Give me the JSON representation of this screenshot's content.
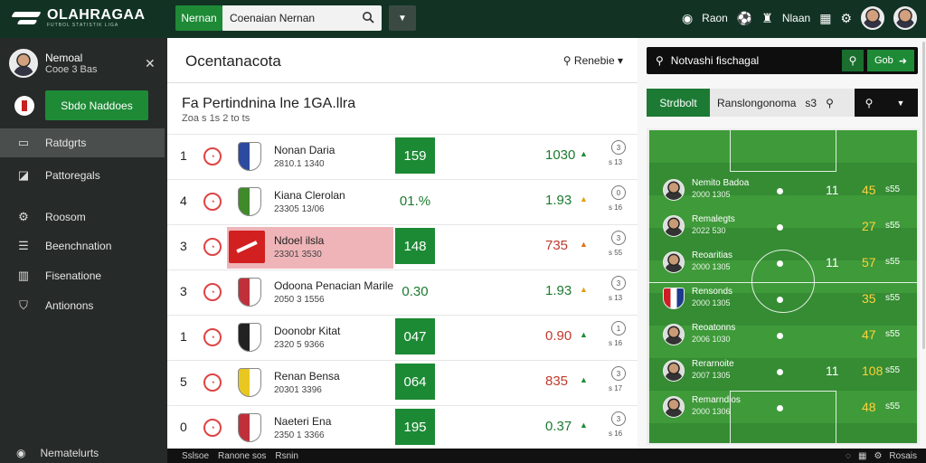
{
  "topbar": {
    "logo": "OLAHRAGAA",
    "logo_tagline": "FUTBOL STATISTIK LIGA",
    "tab": "Nernan",
    "search_value": "Coenaian Nernan",
    "right_items": [
      "Raon",
      "Nlaan"
    ]
  },
  "sidebar": {
    "user_name": "Nemoal",
    "user_sub": "Cooe 3 Bas",
    "cta": "Sbdo Naddoes",
    "items": [
      {
        "label": "Ratdgrts",
        "icon": "list-icon"
      },
      {
        "label": "Pattoregals",
        "icon": "tag-icon"
      },
      {
        "label": "Roosom",
        "icon": "settings-icon"
      },
      {
        "label": "Beenchnation",
        "icon": "table-icon"
      },
      {
        "label": "Fisenatione",
        "icon": "chart-icon"
      },
      {
        "label": "Antionons",
        "icon": "shield-icon"
      }
    ],
    "bottom": "Nematelurts"
  },
  "middle": {
    "title": "Ocentanacota",
    "filter": "Renebie",
    "section_title": "Fa Pertindnina lne 1GA.llra",
    "section_sub": "Zoa s 1s 2 to ts",
    "rows": [
      {
        "rank": "1",
        "name": "Nonan Daria",
        "meta": "2810.1 1340",
        "score": "159",
        "value": "1030",
        "value_color": "#1c7a30",
        "trend": "▲",
        "trend_color": "#1c8a34",
        "highlight": false,
        "crest": "#2c4aa0",
        "act": "3",
        "act_sub": "s 13"
      },
      {
        "rank": "4",
        "name": "Kiana Clerolan",
        "meta": "23305 13/06",
        "score": "01.%",
        "score_plain": true,
        "value": "1.93",
        "value_color": "#1c7a30",
        "trend": "▲",
        "trend_color": "#e0a010",
        "highlight": false,
        "crest": "#3f8a2a",
        "act": "0",
        "act_sub": "s 16"
      },
      {
        "rank": "3",
        "name": "Ndoel ilsla",
        "meta": "23301 3530",
        "score": "148",
        "value": "735",
        "value_color": "#c0392b",
        "trend": "▲",
        "trend_color": "#e07010",
        "highlight": true,
        "crest": "#d21f1f",
        "act": "3",
        "act_sub": "s 55"
      },
      {
        "rank": "3",
        "name": "Odoona Penacian Marile",
        "meta": "2050 3 1556",
        "score": "0.30",
        "score_plain": true,
        "value": "1.93",
        "value_color": "#1c7a30",
        "trend": "▲",
        "trend_color": "#e0a010",
        "highlight": false,
        "crest": "#c0303a",
        "act": "3",
        "act_sub": "s 13"
      },
      {
        "rank": "1",
        "name": "Doonobr Kitat",
        "meta": "2320 5 9366",
        "score": "047",
        "value": "0.90",
        "value_color": "#c0392b",
        "trend": "▲",
        "trend_color": "#1c8a34",
        "highlight": false,
        "crest": "#222222",
        "act": "1",
        "act_sub": "s 16"
      },
      {
        "rank": "5",
        "name": "Renan Bensa",
        "meta": "20301 3396",
        "score": "064",
        "value": "835",
        "value_color": "#c0392b",
        "trend": "▲",
        "trend_color": "#1c8a34",
        "highlight": false,
        "crest": "#e8c820",
        "act": "3",
        "act_sub": "s 17"
      },
      {
        "rank": "0",
        "name": "Naeteri Ena",
        "meta": "2350 1 3366",
        "score": "195",
        "value": "0.37",
        "value_color": "#1c7a30",
        "trend": "▲",
        "trend_color": "#1c8a34",
        "highlight": false,
        "crest": "#c0303a",
        "act": "3",
        "act_sub": "s 16"
      }
    ]
  },
  "right": {
    "search_value": "Notvashi fischagal",
    "go_label": "Gob",
    "tab_active": "Strdbolt",
    "tab_other": "Ranslongonoma",
    "tab_other_count": "s3",
    "players": [
      {
        "name": "Nemito Badoa",
        "meta": "2000 1305",
        "n1": "11",
        "n2": "45",
        "n3": "s55"
      },
      {
        "name": "Remalegts",
        "meta": "2022 530",
        "n1": "",
        "n2": "27",
        "n3": "s55"
      },
      {
        "name": "Reoaritias",
        "meta": "2000 1305",
        "n1": "11",
        "n2": "57",
        "n3": "s55"
      },
      {
        "name": "Rensonds",
        "meta": "2000 1305",
        "n1": "",
        "n2": "35",
        "n3": "s55"
      },
      {
        "name": "Reoatonns",
        "meta": "2006 1030",
        "n1": "",
        "n2": "47",
        "n3": "s55"
      },
      {
        "name": "Rerarnoite",
        "meta": "2007 1305",
        "n1": "11",
        "n2": "108",
        "n3": "s55"
      },
      {
        "name": "Remarndios",
        "meta": "2000 1306",
        "n1": "",
        "n2": "48",
        "n3": "s55"
      }
    ]
  },
  "footer": {
    "links": [
      "Sslsoe",
      "Ranone sos",
      "Rsnin"
    ],
    "right": "Rosais"
  }
}
